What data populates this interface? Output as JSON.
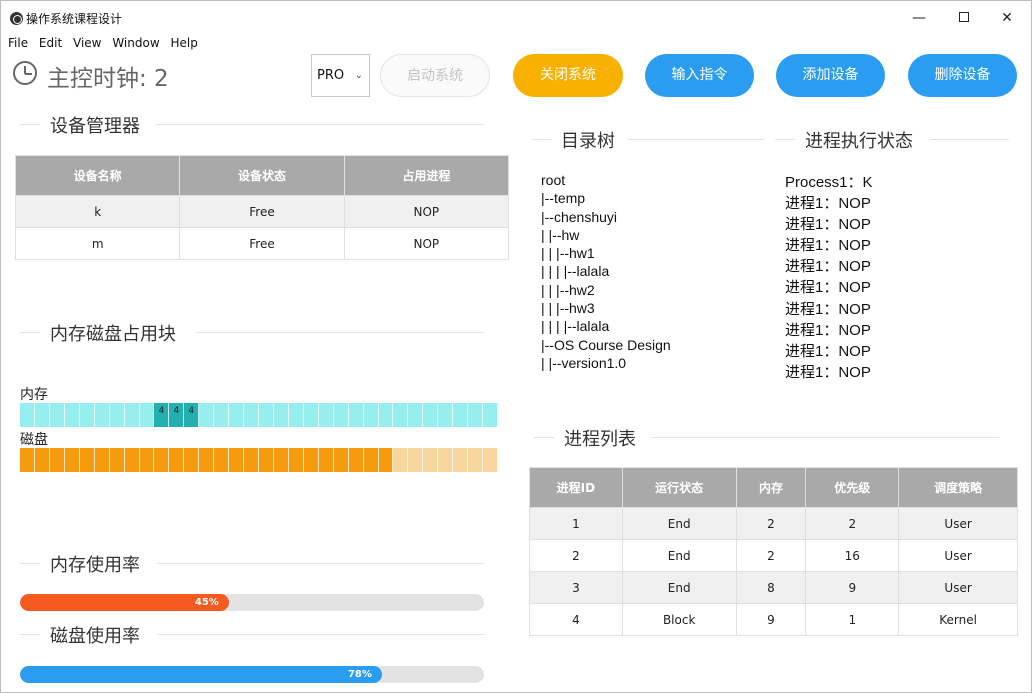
{
  "window": {
    "title": "操作系统课程设计",
    "controls": {
      "minimize": "—",
      "close": "✕"
    }
  },
  "menu": [
    "File",
    "Edit",
    "View",
    "Window",
    "Help"
  ],
  "header": {
    "clock_label": "主控时钟: 2",
    "mode_select": {
      "value": "PRO",
      "chevron": "⌄"
    },
    "buttons": {
      "start": "启动系统",
      "shutdown": "关闭系统",
      "input_command": "输入指令",
      "add_device": "添加设备",
      "delete_device": "删除设备"
    },
    "colors": {
      "orange": "#f8b100",
      "blue": "#2b9df0",
      "disabled_text": "#c3c3c3"
    }
  },
  "device_manager": {
    "title": "设备管理器",
    "columns": [
      "设备名称",
      "设备状态",
      "占用进程"
    ],
    "rows": [
      [
        "k",
        "Free",
        "NOP"
      ],
      [
        "m",
        "Free",
        "NOP"
      ]
    ]
  },
  "storage": {
    "title": "内存磁盘占用块",
    "memory_label": "内存",
    "disk_label": "磁盘",
    "memory_blocks": [
      "",
      "",
      "",
      "",
      "",
      "",
      "",
      "",
      "",
      "4",
      "4",
      "4",
      "",
      "",
      "",
      "",
      "",
      "",
      "",
      "",
      "",
      "",
      "",
      "",
      "",
      "",
      "",
      "",
      "",
      "",
      "",
      ""
    ],
    "memory_used": [
      false,
      false,
      false,
      false,
      false,
      false,
      false,
      false,
      false,
      true,
      true,
      true,
      false,
      false,
      false,
      false,
      false,
      false,
      false,
      false,
      false,
      false,
      false,
      false,
      false,
      false,
      false,
      false,
      false,
      false,
      false,
      false
    ],
    "disk_used_blocks": 25,
    "disk_total_blocks": 32,
    "colors": {
      "mem_free": "#97eeee",
      "mem_used": "#22b1b0",
      "disk_used": "#f59b0d",
      "disk_free": "#f7d79e"
    }
  },
  "memory_usage": {
    "title": "内存使用率",
    "percent": 45,
    "label": "45%",
    "color": "#f55b1f"
  },
  "disk_usage": {
    "title": "磁盘使用率",
    "percent": 78,
    "label": "78%",
    "color": "#2b9df0"
  },
  "directory_tree": {
    "title": "目录树",
    "lines": [
      "root",
      "|--temp",
      "|--chenshuyi",
      "| |--hw",
      "| | |--hw1",
      "| | | |--lalala",
      "| | |--hw2",
      "| | |--hw3",
      "| | | |--lalala",
      "|--OS Course Design",
      "| |--version1.0"
    ]
  },
  "process_status": {
    "title": "进程执行状态",
    "lines": [
      "Process1：K",
      "进程1：NOP",
      "进程1：NOP",
      "进程1：NOP",
      "进程1：NOP",
      "进程1：NOP",
      "进程1：NOP",
      "进程1：NOP",
      "进程1：NOP",
      "进程1：NOP"
    ]
  },
  "process_list": {
    "title": "进程列表",
    "columns": [
      "进程ID",
      "运行状态",
      "内存",
      "优先级",
      "调度策略"
    ],
    "rows": [
      [
        "1",
        "End",
        "2",
        "2",
        "User"
      ],
      [
        "2",
        "End",
        "2",
        "16",
        "User"
      ],
      [
        "3",
        "End",
        "8",
        "9",
        "User"
      ],
      [
        "4",
        "Block",
        "9",
        "1",
        "Kernel"
      ]
    ]
  }
}
